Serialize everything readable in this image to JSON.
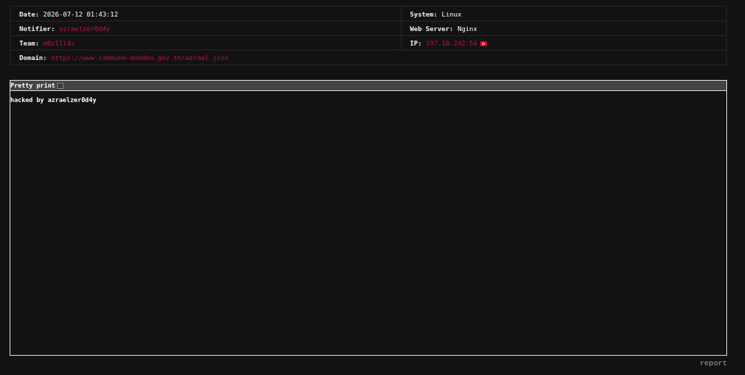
{
  "info_rows": [
    {
      "cells": [
        {
          "label": "Date:",
          "value": "2026-07-12 01:43:12",
          "kind": "plain"
        },
        {
          "label": "System:",
          "value": "Linux",
          "kind": "plain"
        }
      ]
    },
    {
      "cells": [
        {
          "label": "Notifier:",
          "value": "azraelzer0d4y",
          "kind": "link"
        },
        {
          "label": "Web Server:",
          "value": "Nginx",
          "kind": "plain"
        }
      ]
    },
    {
      "cells": [
        {
          "label": "Team:",
          "value": "m0z1ll4s",
          "kind": "link"
        },
        {
          "label": "IP:",
          "value": "197.10.242.54",
          "kind": "ip"
        }
      ]
    },
    {
      "cells": [
        {
          "label": "Domain:",
          "value": "https://www.commune-denden.gov.tn/azrael.json",
          "kind": "link"
        }
      ]
    }
  ],
  "viewer": {
    "label": "Pretty print",
    "checked": false,
    "content": "hacked by azraelzer0d4y"
  },
  "report": "report"
}
